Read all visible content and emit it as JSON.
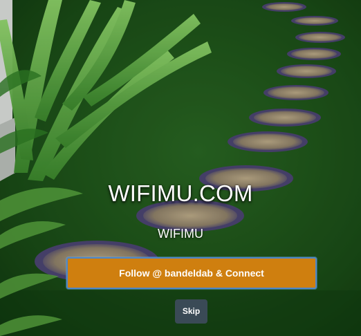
{
  "portal": {
    "site_title": "WIFIMU.COM",
    "network_name": "WIFIMU",
    "connect_label": "Follow @ bandeldab & Connect",
    "skip_label": "Skip"
  },
  "background": {
    "description_icon": "garden-stepping-stones-background"
  },
  "colors": {
    "connect_button": "#cf7f0f",
    "connect_border": "#4f86c6",
    "skip_button": "#3a4a56",
    "grass": "#1f5a1c"
  }
}
